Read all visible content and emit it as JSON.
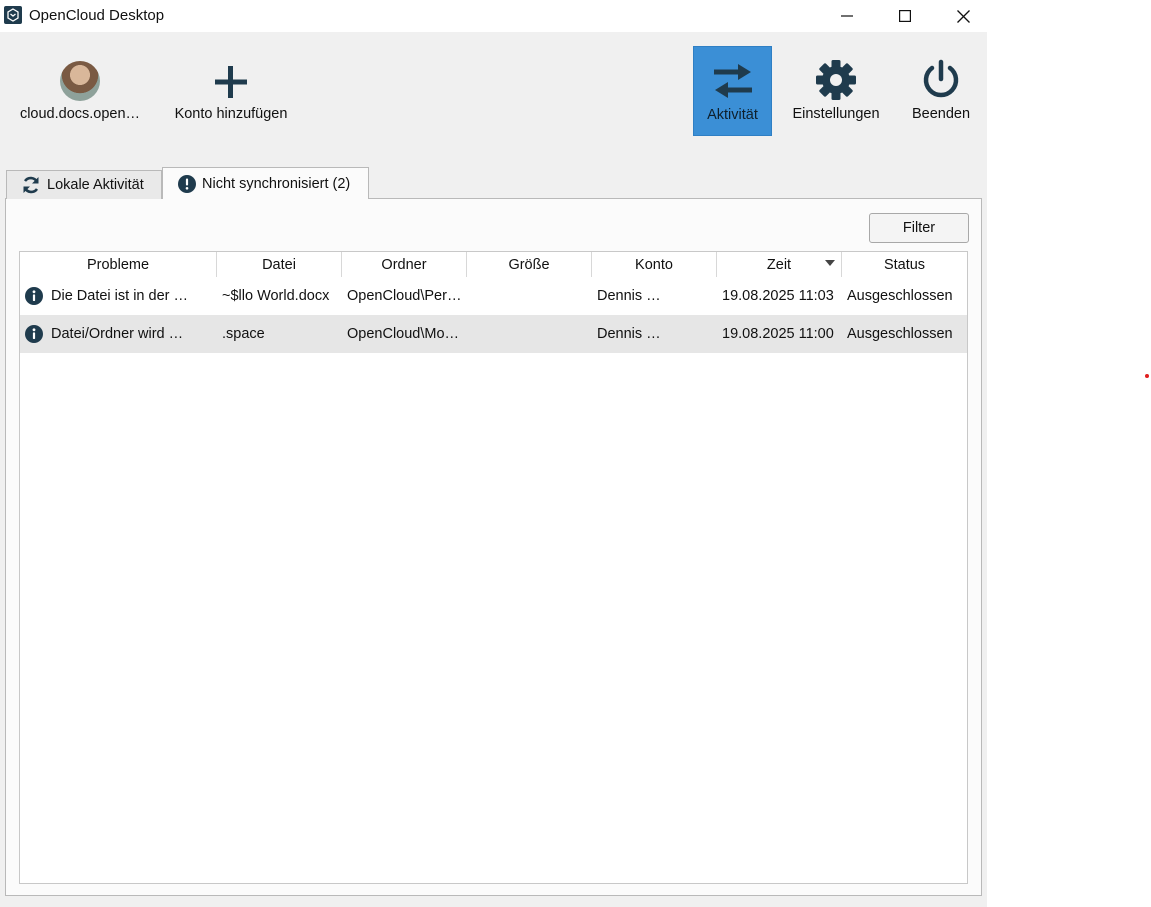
{
  "window": {
    "title": "OpenCloud Desktop",
    "controls": {
      "minimize": "minimize-icon",
      "maximize": "maximize-icon",
      "close": "close-icon"
    }
  },
  "toolbar": {
    "account_label": "cloud.docs.open…",
    "add_account_label": "Konto hinzufügen",
    "activity_label": "Aktivität",
    "settings_label": "Einstellungen",
    "quit_label": "Beenden",
    "accent": "#3b8fd6",
    "icon_color": "#1f3b4d"
  },
  "tabs": [
    {
      "label": "Lokale Aktivität",
      "icon": "sync-icon",
      "active": false
    },
    {
      "label": "Nicht synchronisiert (2)",
      "icon": "alert-icon",
      "active": true
    }
  ],
  "filter_label": "Filter",
  "table": {
    "columns": [
      "Probleme",
      "Datei",
      "Ordner",
      "Größe",
      "Konto",
      "Zeit",
      "Status"
    ],
    "sorted_column": "Zeit",
    "rows": [
      {
        "problem": "Die Datei ist in der …",
        "file": "~$llo World.docx",
        "folder": "OpenCloud\\Per…",
        "size": "",
        "account": "Dennis …",
        "time": "19.08.2025 11:03",
        "status": "Ausgeschlossen",
        "selected": false
      },
      {
        "problem": "Datei/Ordner wird …",
        "file": ".space",
        "folder": "OpenCloud\\Mo…",
        "size": "",
        "account": "Dennis …",
        "time": "19.08.2025 11:00",
        "status": "Ausgeschlossen",
        "selected": true
      }
    ]
  }
}
